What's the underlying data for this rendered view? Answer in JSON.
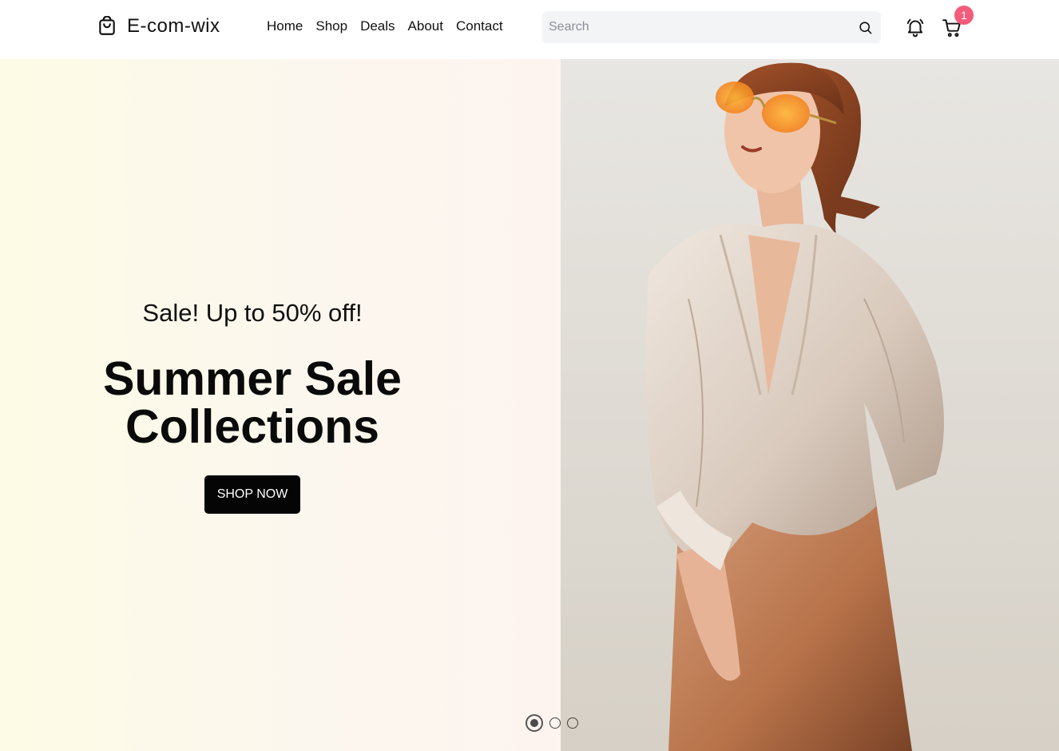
{
  "header": {
    "brand": "E-com-wix",
    "nav": [
      "Home",
      "Shop",
      "Deals",
      "About",
      "Contact"
    ],
    "search_placeholder": "Search",
    "cart_count": "1"
  },
  "hero": {
    "subtitle": "Sale! Up to 50% off!",
    "title_line1": "Summer Sale",
    "title_line2": "Collections",
    "cta": "SHOP NOW"
  },
  "slider": {
    "active_index": 0,
    "count": 3
  },
  "colors": {
    "badge": "#f35c7a",
    "cta_bg": "#050505",
    "hero_gradient_start": "#fdfbe6",
    "hero_gradient_end": "#fdf4f0"
  },
  "icons": [
    "shopping-bag-icon",
    "search-icon",
    "bell-icon",
    "cart-icon"
  ]
}
